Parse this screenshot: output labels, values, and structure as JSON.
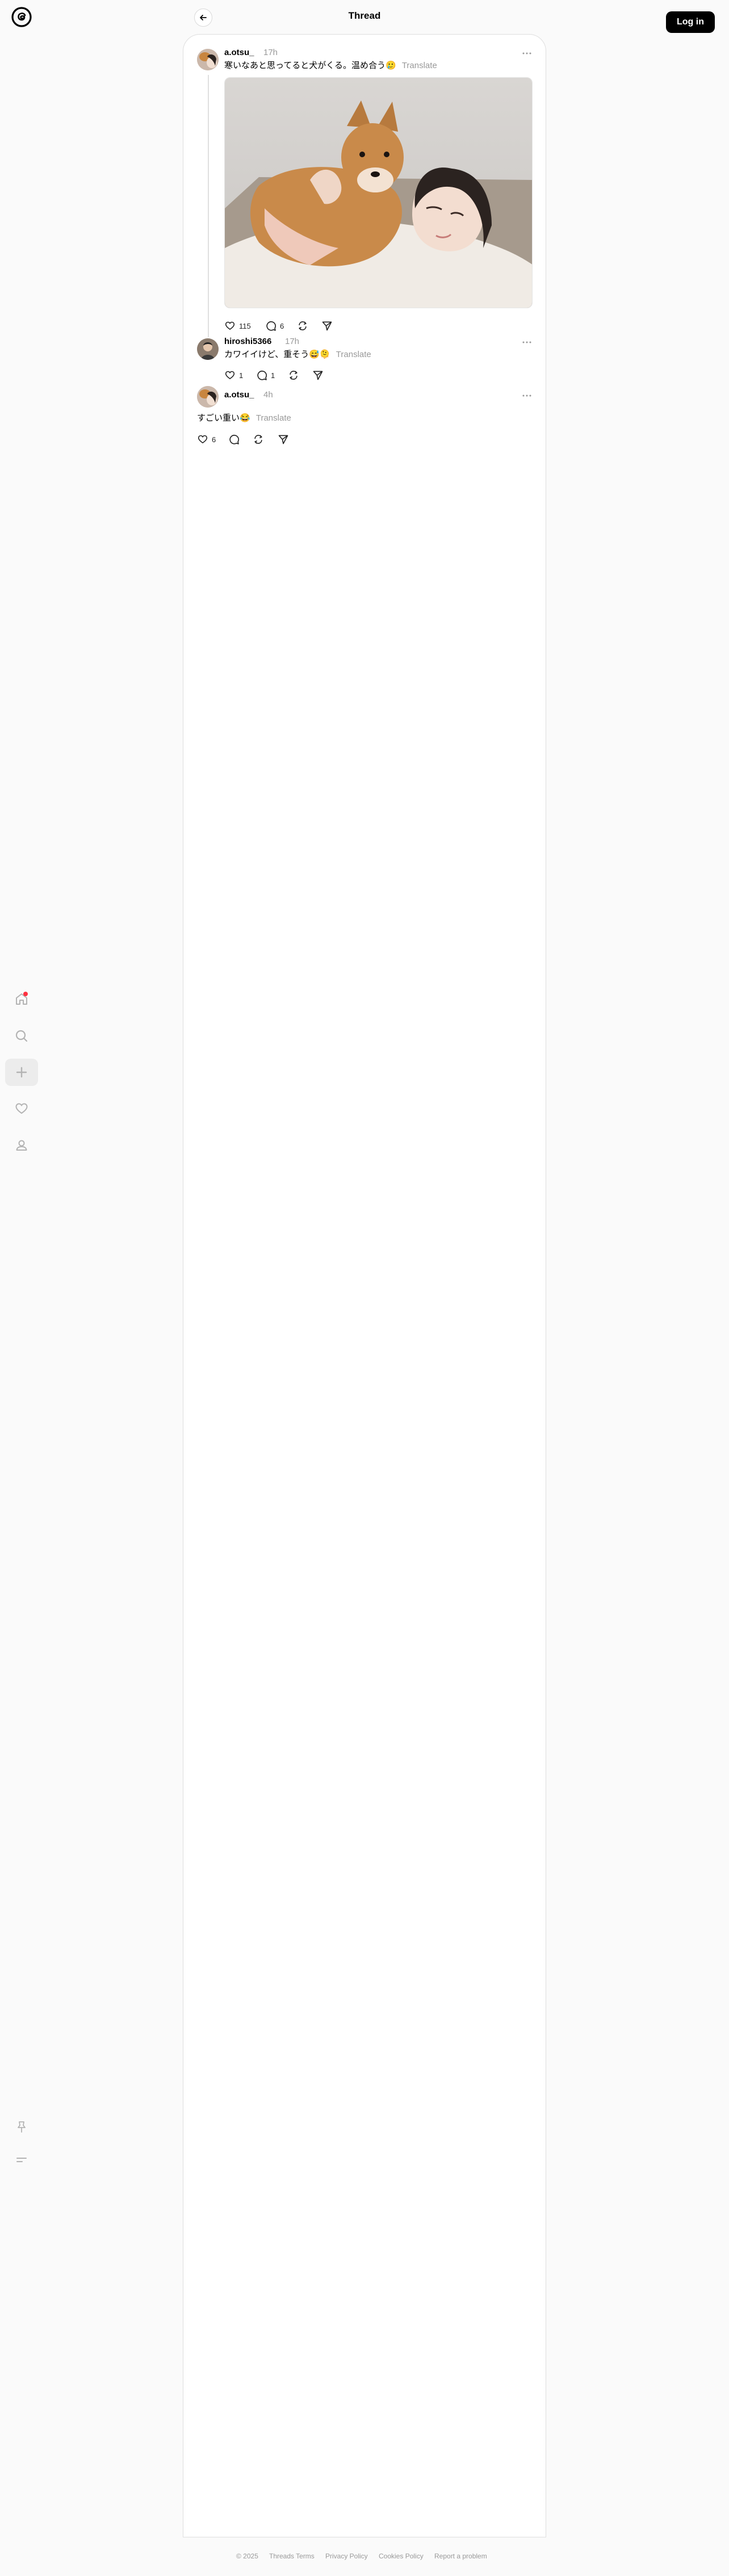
{
  "header": {
    "title": "Thread",
    "login_label": "Log in"
  },
  "posts": [
    {
      "username": "a.otsu_",
      "time": "17h",
      "text": "寒いなあと思ってると犬がくる。温め合う🥲",
      "translate_label": "Translate",
      "likes": "115",
      "replies": "6"
    },
    {
      "username": "hiroshi5366",
      "time": "17h",
      "text": "カワイイけど、重そう😅🫠",
      "translate_label": "Translate",
      "likes": "1",
      "replies": "1"
    },
    {
      "username": "a.otsu_",
      "time": "4h",
      "text": "すごい重い😂",
      "translate_label": "Translate",
      "likes": "6",
      "replies": ""
    }
  ],
  "footer": {
    "copyright": "© 2025",
    "links": [
      "Threads Terms",
      "Privacy Policy",
      "Cookies Policy",
      "Report a problem"
    ]
  },
  "colors": {
    "accent": "#ff3040",
    "button_bg": "#000000",
    "muted_text": "#999999"
  }
}
